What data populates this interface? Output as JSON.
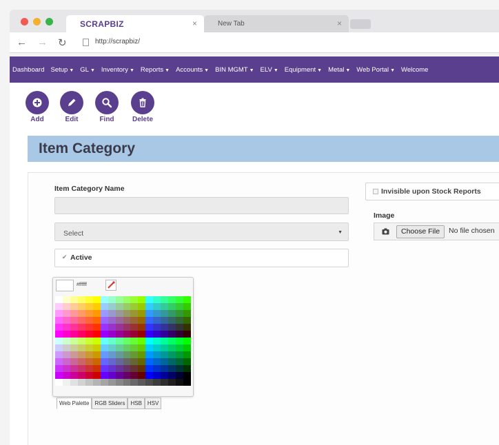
{
  "browser": {
    "tabs": [
      {
        "title_main": "SCRAP",
        "title_accent": "BIZ",
        "close": "×"
      },
      {
        "title": "New Tab",
        "close": "×"
      }
    ],
    "url": "http://scrapbiz/"
  },
  "nav": {
    "items": [
      {
        "label": "Dashboard",
        "dropdown": false
      },
      {
        "label": "Setup",
        "dropdown": true
      },
      {
        "label": "GL",
        "dropdown": true
      },
      {
        "label": "Inventory",
        "dropdown": true
      },
      {
        "label": "Reports",
        "dropdown": true
      },
      {
        "label": "Accounts",
        "dropdown": true
      },
      {
        "label": "BIN MGMT",
        "dropdown": true
      },
      {
        "label": "ELV",
        "dropdown": true
      },
      {
        "label": "Equipment",
        "dropdown": true
      },
      {
        "label": "Metal",
        "dropdown": true
      },
      {
        "label": "Web Portal",
        "dropdown": true
      },
      {
        "label": "Welcome",
        "dropdown": false
      }
    ]
  },
  "toolbar": {
    "add_label": "Add",
    "edit_label": "Edit",
    "find_label": "Find",
    "delete_label": "Delete"
  },
  "page": {
    "title": "Item Category"
  },
  "form": {
    "name_label": "Item Category Name",
    "name_value": "",
    "select_value": "Select",
    "active_label": "Active",
    "active_checked": true,
    "invisible_label": "Invisible upon Stock Reports",
    "invisible_checked": false,
    "image_label": "Image",
    "choose_file_label": "Choose File",
    "file_status": "No file chosen"
  },
  "color_picker": {
    "current_hex": "#ffffff",
    "tabs": [
      "Web Palette",
      "RGB Sliders",
      "HSB",
      "HSV"
    ],
    "active_tab": "Web Palette"
  },
  "colors": {
    "brand": "#5b3f8f",
    "header_band": "#a9c8e6"
  }
}
